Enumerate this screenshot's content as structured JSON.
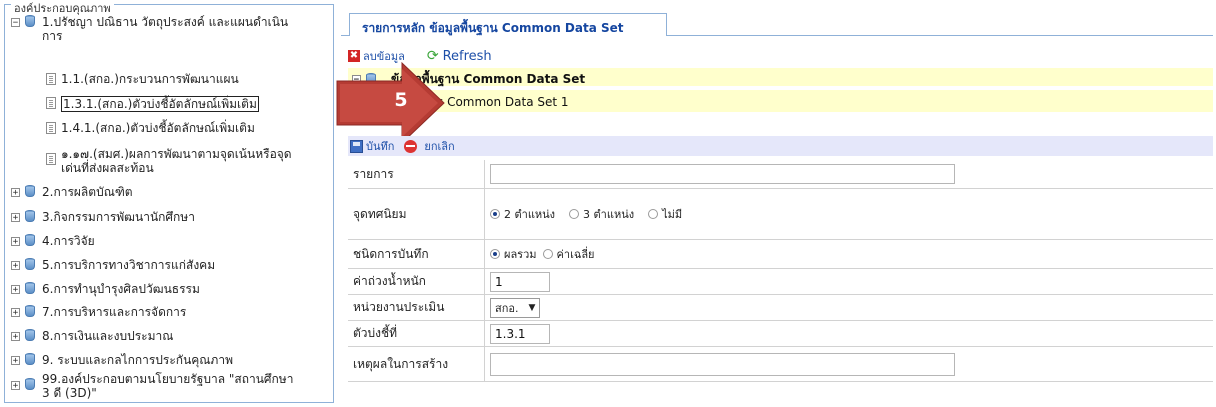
{
  "left": {
    "legend": "องค์ประกอบคุณภาพ",
    "items": [
      {
        "toggle": "−",
        "label": "1.ปรัชญา ปณิธาน วัตถุประสงค์ และแผนดำเนิน",
        "label2": "การ"
      },
      {
        "label": "1.1.(สกอ.)กระบวนการพัฒนาแผน"
      },
      {
        "label": "1.3.1.(สกอ.)ตัวบ่งชี้อัตลักษณ์เพิ่มเติม"
      },
      {
        "label": "1.4.1.(สกอ.)ตัวบ่งชี้อัตลักษณ์เพิ่มเติม"
      },
      {
        "label": "๑.๑๗.(สมศ.)ผลการพัฒนาตามจุดเน้นหรือจุด",
        "label2": "เด่นที่ส่งผลสะท้อน"
      },
      {
        "toggle": "+",
        "label": "2.การผลิตบัณฑิต"
      },
      {
        "toggle": "+",
        "label": "3.กิจกรรมการพัฒนานักศึกษา"
      },
      {
        "toggle": "+",
        "label": "4.การวิจัย"
      },
      {
        "toggle": "+",
        "label": "5.การบริการทางวิชาการแก่สังคม"
      },
      {
        "toggle": "+",
        "label": "6.การทำนุบำรุงศิลปวัฒนธรรม"
      },
      {
        "toggle": "+",
        "label": "7.การบริหารและการจัดการ"
      },
      {
        "toggle": "+",
        "label": "8.การเงินและงบประมาณ"
      },
      {
        "toggle": "+",
        "label": "9. ระบบและกลไกการประกันคุณภาพ"
      },
      {
        "toggle": "+",
        "label": "99.องค์ประกอบตามนโยบายรัฐบาล \"สถานศึกษา",
        "label2": "3 ดี (3D)\""
      }
    ]
  },
  "tab": {
    "label": "รายการหลัก ข้อมูลพื้นฐาน Common Data Set"
  },
  "toolbar1": {
    "delete_label": "ลบข้อมูล",
    "refresh_label": "Refresh"
  },
  "header": {
    "row1_label": "ข้อมูลพื้นฐาน Common Data Set",
    "row2_label": "s Common Data Set 1"
  },
  "annotation": {
    "step": "5",
    "color": "#b53b33"
  },
  "toolbar2": {
    "save_label": "บันทึก",
    "cancel_label": "ยกเลิก"
  },
  "form": {
    "item_label": "รายการ",
    "item_value": "",
    "decimal_label": "จุดทศนิยม",
    "decimal_options": [
      "2 ตำแหน่ง",
      "3 ตำแหน่ง",
      "ไม่มี"
    ],
    "record_label": "ชนิดการบันทึก",
    "record_options": [
      "ผลรวม",
      "ค่าเฉลี่ย"
    ],
    "weight_label": "ค่าถ่วงน้ำหนัก",
    "weight_value": "1",
    "unit_label": "หน่วยงานประเมิน",
    "unit_value": "สกอ.",
    "indicator_label": "ตัวบ่งชี้ที่",
    "indicator_value": "1.3.1",
    "reason_label": "เหตุผลในการสร้าง",
    "reason_value": ""
  }
}
